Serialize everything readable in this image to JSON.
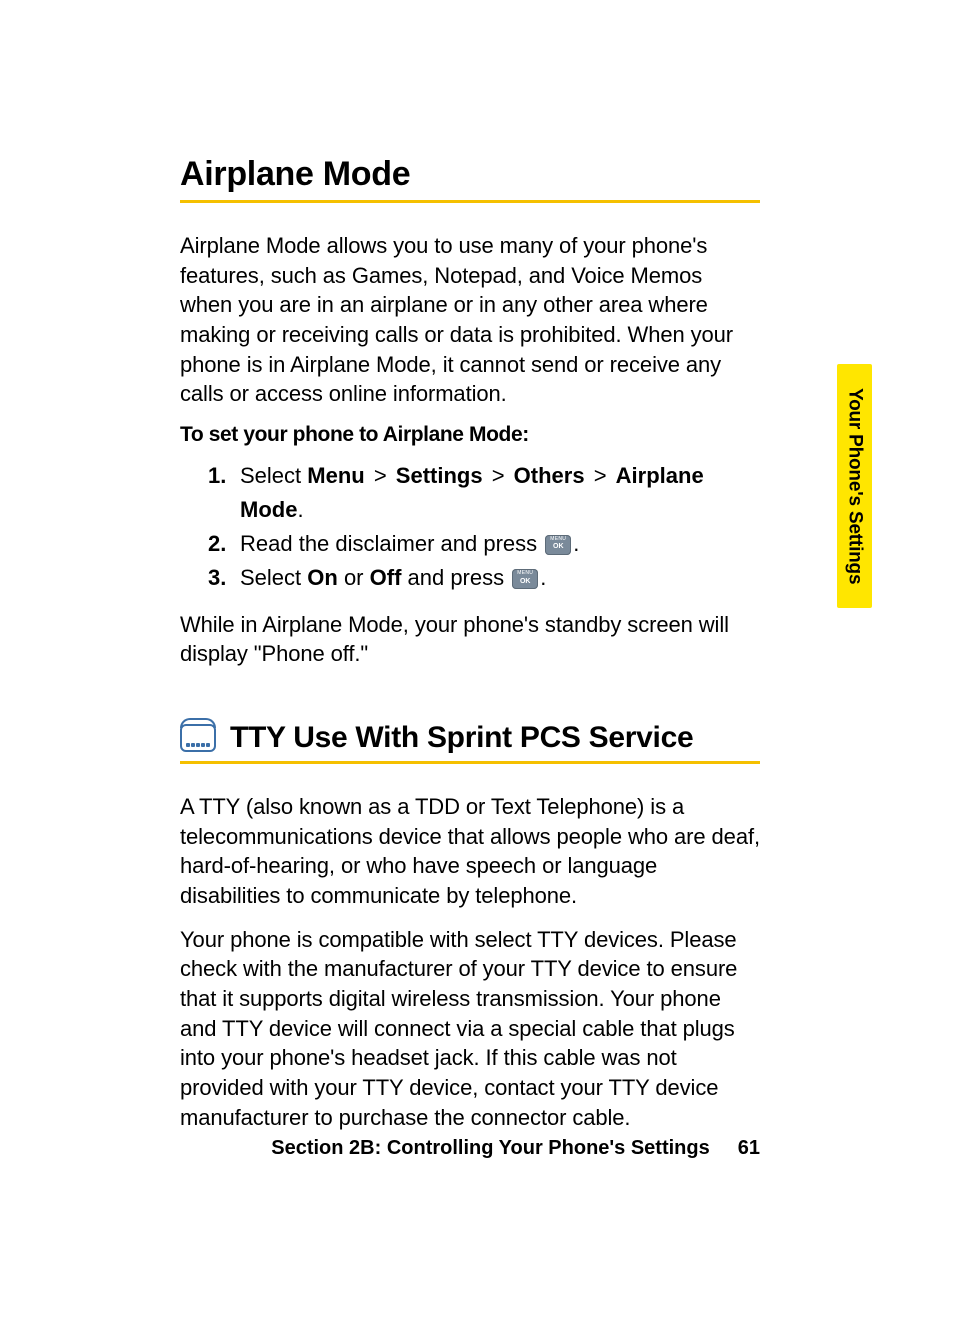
{
  "sections": {
    "airplane": {
      "title": "Airplane Mode",
      "intro": "Airplane Mode allows you to use many of your phone's features, such as Games, Notepad, and Voice Memos when you are in an airplane or in any other area where making or receiving calls or data is prohibited. When your phone is in Airplane Mode, it cannot send or receive any calls or access online information.",
      "instruction_heading": "To set your phone to Airplane Mode:",
      "steps": {
        "s1": {
          "num": "1.",
          "lead": "Select ",
          "menu": "Menu",
          "sep": " > ",
          "settings": "Settings",
          "others": "Others",
          "airplane": "Airplane Mode",
          "period": "."
        },
        "s2": {
          "num": "2.",
          "text_before": "Read the disclaimer and press ",
          "period": "."
        },
        "s3": {
          "num": "3.",
          "lead": "Select ",
          "on": "On",
          "or": " or ",
          "off": "Off",
          "after": " and press ",
          "period": "."
        }
      },
      "outro": "While in Airplane Mode, your phone's standby screen will display \"Phone off.\""
    },
    "tty": {
      "title": "TTY Use With Sprint PCS Service",
      "p1": "A TTY (also known as a TDD or Text Telephone) is a telecommunications device that allows people who are deaf, hard-of-hearing, or who have speech or language disabilities to communicate by telephone.",
      "p2": "Your phone is compatible with select TTY devices. Please check with the manufacturer of your TTY device to ensure that it supports digital wireless transmission. Your phone and TTY device will connect via a special cable that plugs into your phone's headset jack. If this cable was not provided with your TTY device, contact your TTY device manufacturer to purchase the connector cable."
    }
  },
  "side_tab": "Your Phone's Settings",
  "footer": {
    "section": "Section 2B: Controlling Your Phone's Settings",
    "page": "61"
  }
}
